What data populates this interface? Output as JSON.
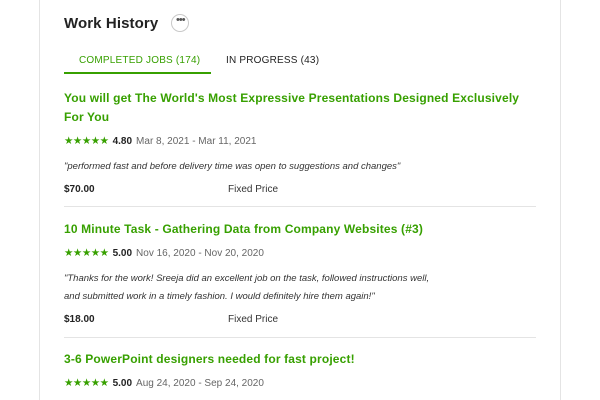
{
  "header": {
    "title": "Work History",
    "more_label": "•••"
  },
  "tabs": [
    {
      "label": "COMPLETED JOBS (174)",
      "active": true
    },
    {
      "label": "IN PROGRESS (43)",
      "active": false
    }
  ],
  "colors": {
    "accent": "#37a000",
    "text": "#222222",
    "muted": "#666666",
    "divider": "#e4e4e4"
  },
  "jobs": [
    {
      "title_line1": "You will get The World's Most Expressive Presentations Designed Exclusively",
      "title_line2": "For You",
      "stars": "★★★★★",
      "rating": "4.80",
      "dates": "Mar 8, 2021 - Mar 11, 2021",
      "feedback_line1": "\"performed fast and before delivery time was open to suggestions and changes\"",
      "feedback_line2": "",
      "price": "$70.00",
      "price_type": "Fixed Price"
    },
    {
      "title_line1": "10 Minute Task - Gathering Data from Company Websites (#3)",
      "title_line2": "",
      "stars": "★★★★★",
      "rating": "5.00",
      "dates": "Nov 16, 2020 - Nov 20, 2020",
      "feedback_line1": "\"Thanks for the work! Sreeja did an excellent job on the task, followed instructions well,",
      "feedback_line2": "and submitted work in a timely fashion. I would definitely hire them again!\"",
      "price": "$18.00",
      "price_type": "Fixed Price"
    },
    {
      "title_line1": "3-6 PowerPoint designers needed for fast project!",
      "title_line2": "",
      "stars": "★★★★★",
      "rating": "5.00",
      "dates": "Aug 24, 2020 - Sep 24, 2020"
    }
  ]
}
